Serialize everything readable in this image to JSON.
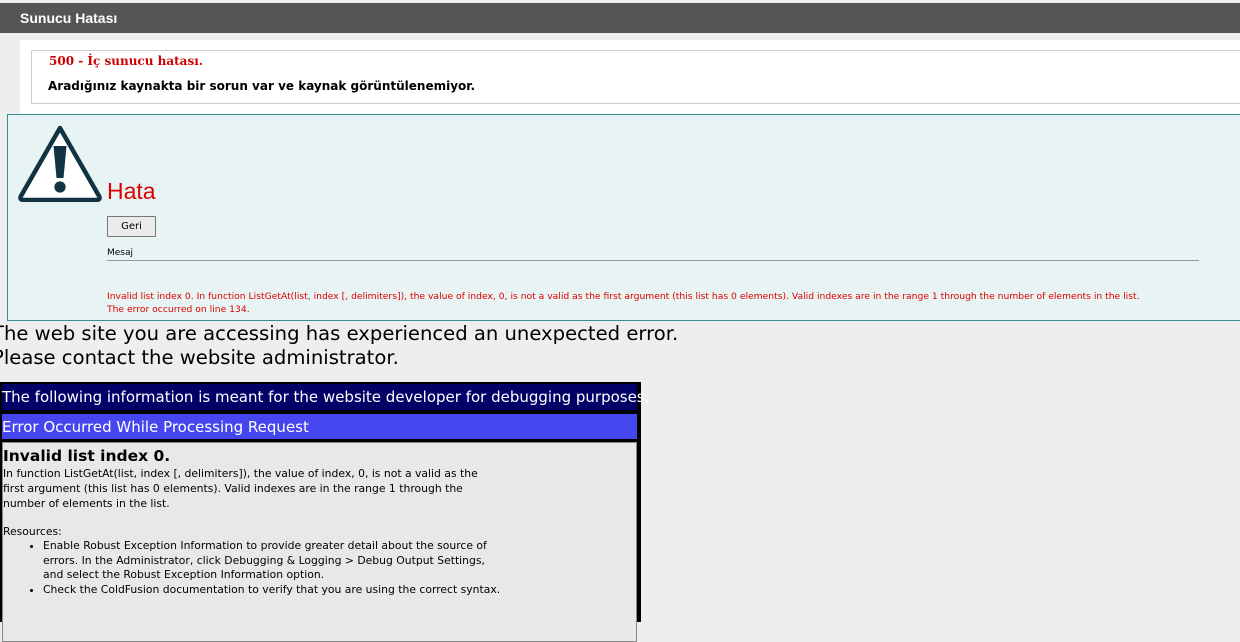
{
  "topbar": {
    "title": "Sunucu Hatası"
  },
  "iis": {
    "title": "500 - İç sunucu hatası.",
    "message": "Aradığınız kaynakta bir sorun var ve kaynak görüntülenemiyor."
  },
  "cf_panel": {
    "heading": "Hata",
    "back_button": "Geri",
    "message_label": "Mesaj",
    "error_line1": "Invalid list index 0. In function ListGetAt(list, index [, delimiters]), the value of index, 0, is not a valid as the first argument (this list has 0 elements). Valid indexes are in the range 1 through the number of elements in the list.",
    "error_line2": "The error occurred on line 134."
  },
  "notice": {
    "line1": "The web site you are accessing has experienced an unexpected error.",
    "line2": "Please contact the website administrator."
  },
  "debug": {
    "header": "The following information is meant for the website developer for debugging purposes.",
    "subheader": "Error Occurred While Processing Request",
    "error_title": "Invalid list index 0.",
    "detail_line1": "In function ListGetAt(list, index [, delimiters]), the value of index, 0, is not a valid as the",
    "detail_line2": "first argument (this list has 0 elements). Valid indexes are in the range 1 through the",
    "detail_line3": "number of elements in the list.",
    "resources_label": "Resources:",
    "resources": [
      {
        "line1": "Enable Robust Exception Information to provide greater detail about the source of",
        "line2": "errors. In the Administrator, click Debugging & Logging > Debug Output Settings,",
        "line3": "and select the Robust Exception Information option."
      },
      {
        "line1": "Check the ColdFusion documentation to verify that you are using the correct syntax."
      }
    ]
  }
}
